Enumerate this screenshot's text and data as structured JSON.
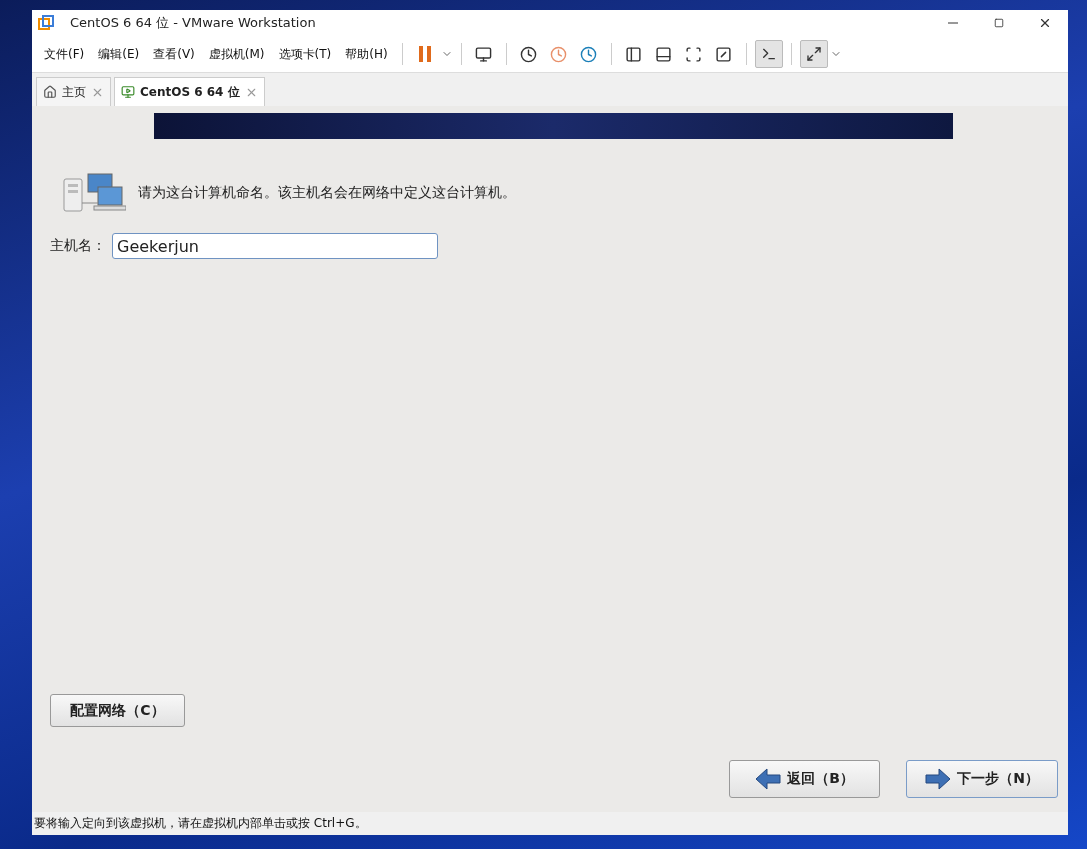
{
  "window": {
    "title": "CentOS 6 64 位 - VMware Workstation"
  },
  "menu": [
    "文件(F)",
    "编辑(E)",
    "查看(V)",
    "虚拟机(M)",
    "选项卡(T)",
    "帮助(H)"
  ],
  "tabs": [
    {
      "label": "主页",
      "kind": "home",
      "selected": false
    },
    {
      "label": "CentOS 6 64 位",
      "kind": "vm",
      "selected": true
    }
  ],
  "installer": {
    "intro": "请为这台计算机命名。该主机名会在网络中定义这台计算机。",
    "hostname_label": "主机名：",
    "hostname_value": "Geekerjun",
    "configure_button": "配置网络（C）",
    "back_button": "返回（B）",
    "next_button": "下一步（N）"
  },
  "status_bar": "要将输入定向到该虚拟机，请在虚拟机内部单击或按 Ctrl+G。"
}
